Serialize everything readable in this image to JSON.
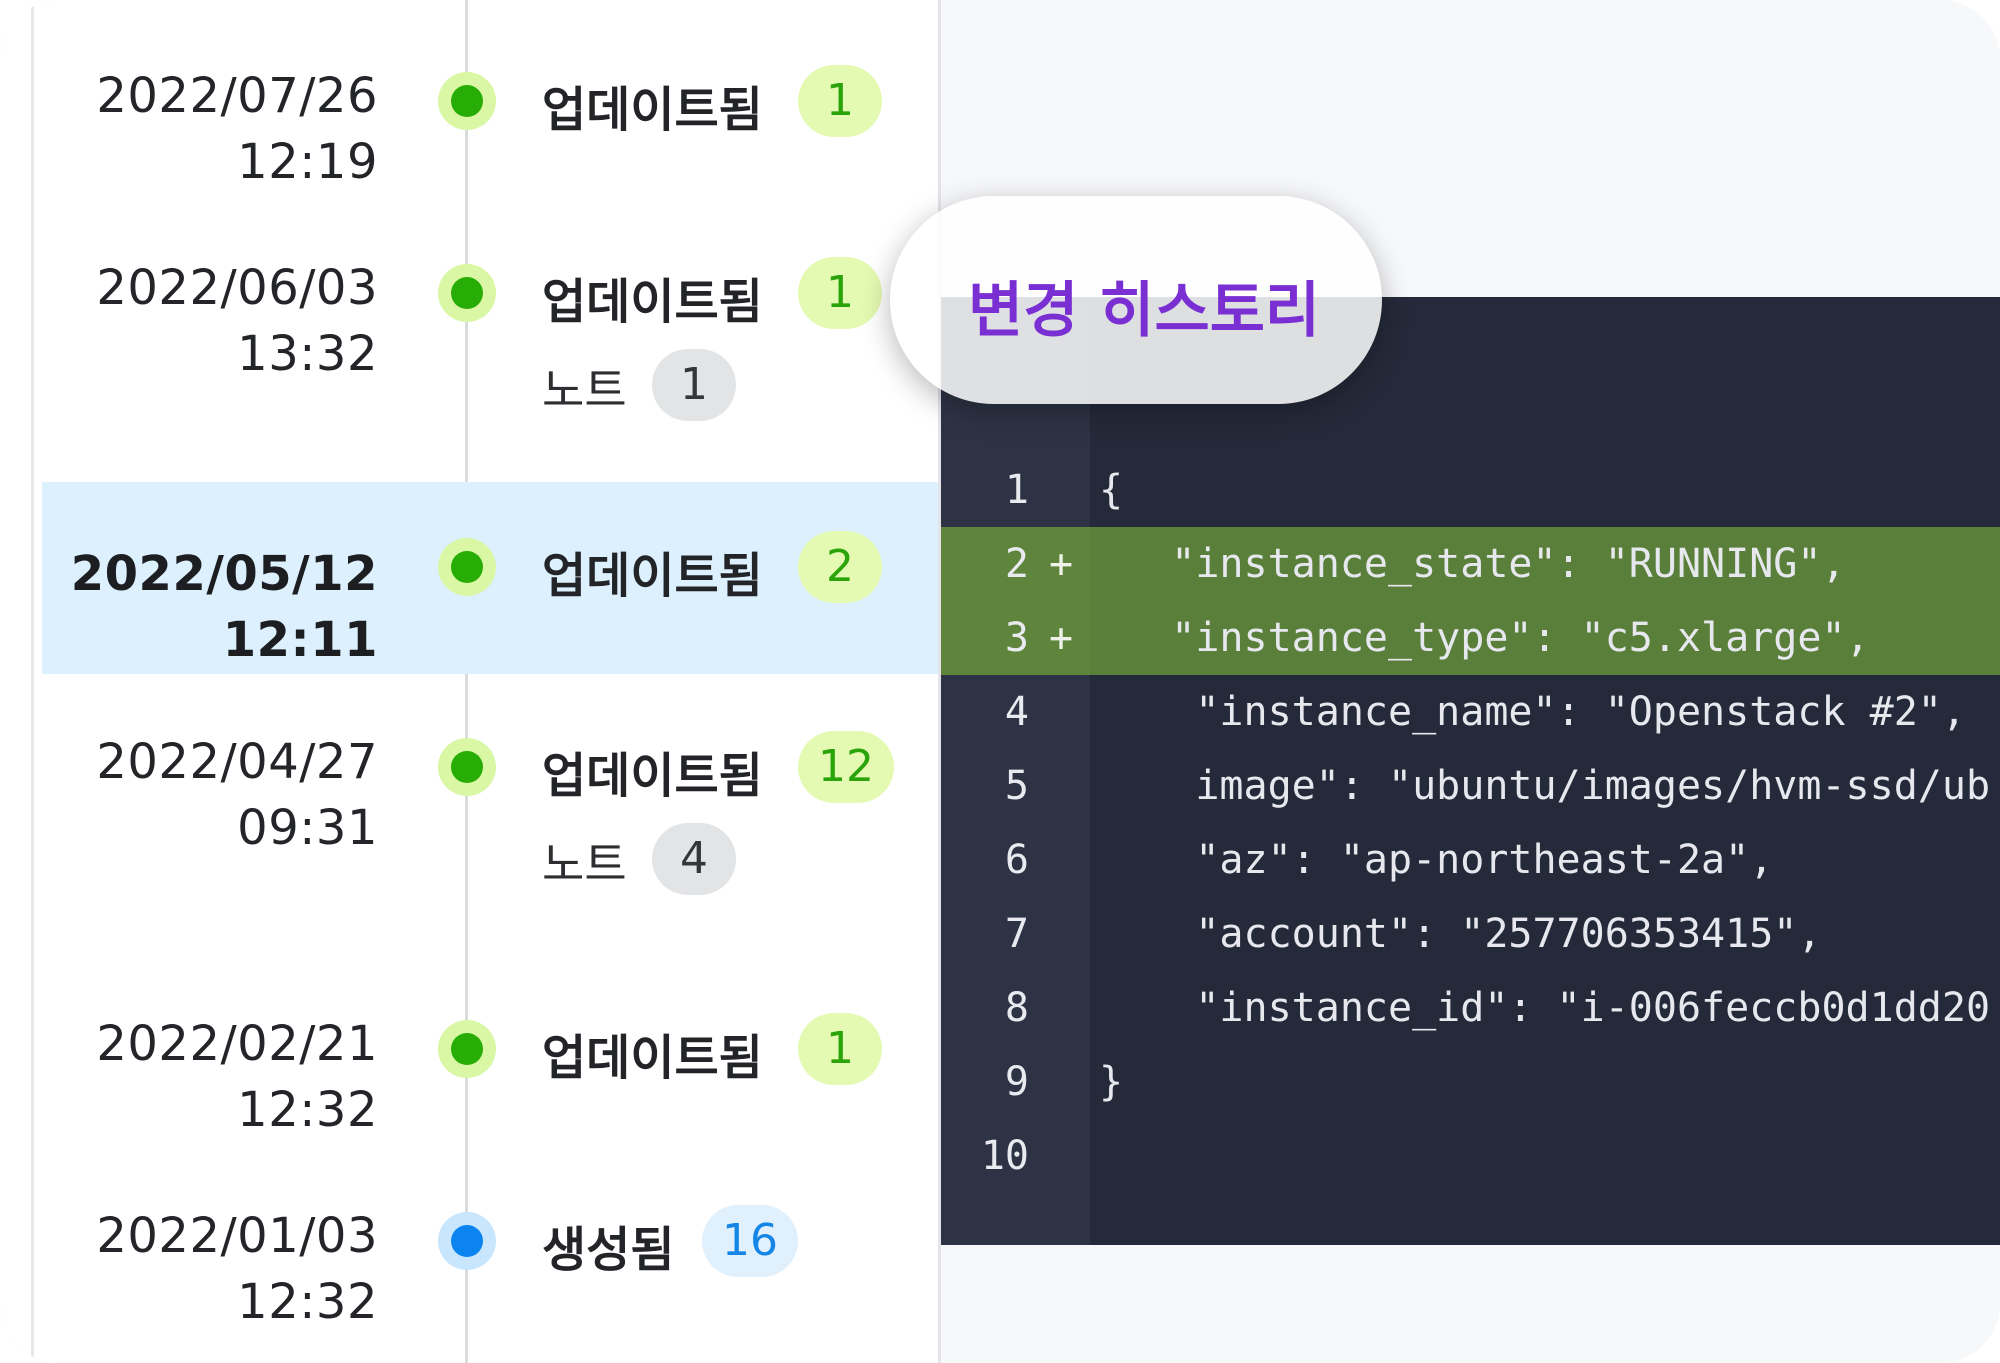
{
  "timeline": {
    "entries": [
      {
        "date": "2022/07/26",
        "time": "12:19",
        "label": "업데이트됨",
        "count": "1",
        "kind": "update",
        "selected": false
      },
      {
        "date": "2022/06/03",
        "time": "13:32",
        "label": "업데이트됨",
        "count": "1",
        "kind": "update",
        "selected": false,
        "note_label": "노트",
        "note_count": "1"
      },
      {
        "date": "2022/05/12",
        "time": "12:11",
        "label": "업데이트됨",
        "count": "2",
        "kind": "update",
        "selected": true
      },
      {
        "date": "2022/04/27",
        "time": "09:31",
        "label": "업데이트됨",
        "count": "12",
        "kind": "update",
        "selected": false,
        "note_label": "노트",
        "note_count": "4"
      },
      {
        "date": "2022/02/21",
        "time": "12:32",
        "label": "업데이트됨",
        "count": "1",
        "kind": "update",
        "selected": false
      },
      {
        "date": "2022/01/03",
        "time": "12:32",
        "label": "생성됨",
        "count": "16",
        "kind": "create",
        "selected": false
      }
    ]
  },
  "tooltip": {
    "title": "변경 히스토리"
  },
  "code": {
    "lines": [
      {
        "number": "1",
        "marker": "",
        "text": "{",
        "added": false
      },
      {
        "number": "2",
        "marker": "+",
        "text": "   \"instance_state\": \"RUNNING\",",
        "added": true
      },
      {
        "number": "3",
        "marker": "+",
        "text": "   \"instance_type\": \"c5.xlarge\",",
        "added": true
      },
      {
        "number": "4",
        "marker": "",
        "text": "    \"instance_name\": \"Openstack #2\",",
        "added": false
      },
      {
        "number": "5",
        "marker": "",
        "text": "    image\": \"ubuntu/images/hvm-ssd/ub",
        "added": false
      },
      {
        "number": "6",
        "marker": "",
        "text": "    \"az\": \"ap-northeast-2a\",",
        "added": false
      },
      {
        "number": "7",
        "marker": "",
        "text": "    \"account\": \"257706353415\",",
        "added": false
      },
      {
        "number": "8",
        "marker": "",
        "text": "    \"instance_id\": \"i-006feccb0d1dd20",
        "added": false
      },
      {
        "number": "9",
        "marker": "",
        "text": "}",
        "added": false
      },
      {
        "number": "10",
        "marker": "",
        "text": "",
        "added": false
      }
    ]
  },
  "colors": {
    "accent_purple": "#7a2fd3",
    "update_green": "#27ad05",
    "create_blue": "#0b84f0",
    "selected_row": "#dcf0fd",
    "added_line": "#5a7f3a",
    "code_bg": "#252a3a"
  }
}
